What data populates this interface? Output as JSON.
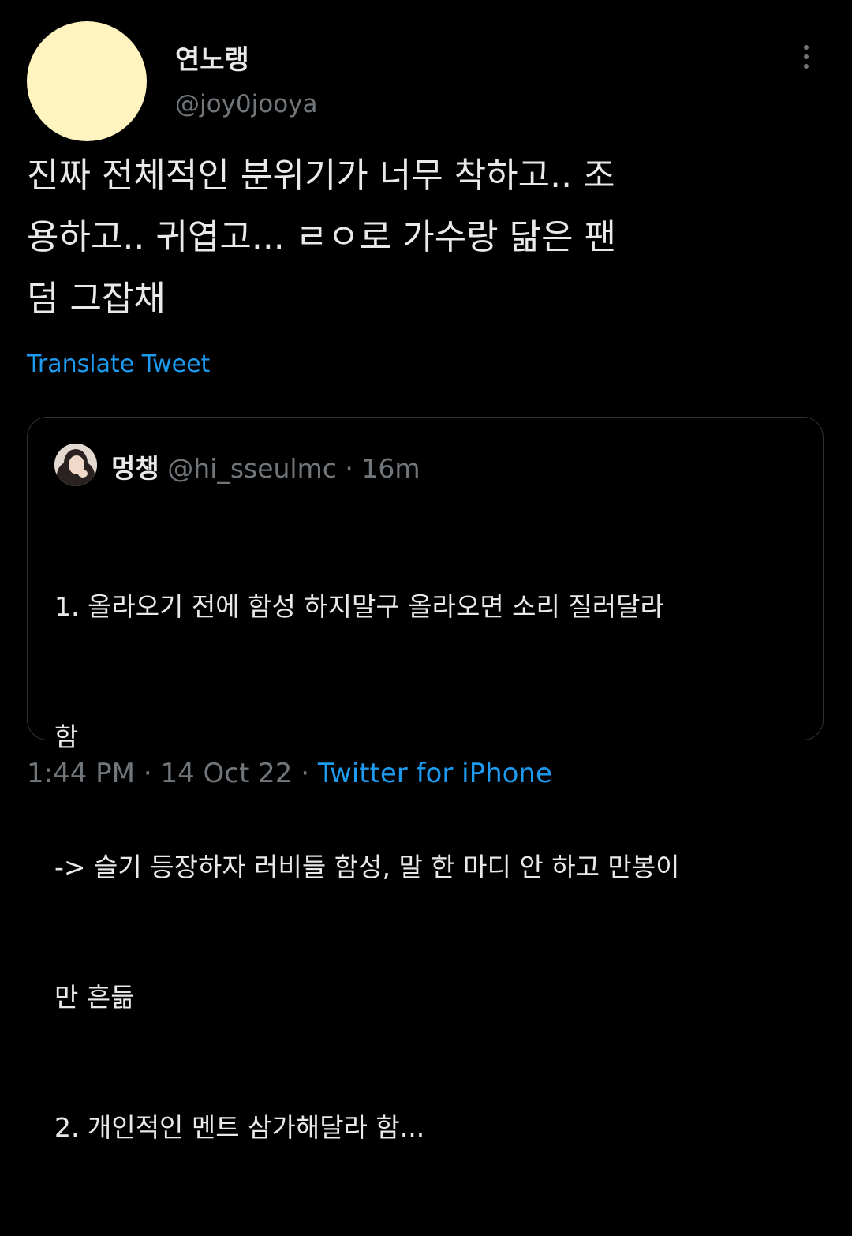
{
  "author": {
    "display_name": "연노랭",
    "handle": "@joy0jooya",
    "avatar_color": "#fff4c0"
  },
  "actions": {
    "more_icon": "more-vertical-icon"
  },
  "tweet": {
    "text": "진짜 전체적인 분위기가 너무 착하고.. 조\n용하고.. 귀엽고... ㄹㅇ로 가수랑 닮은 팬\n덤 그잡채",
    "translate_label": "Translate Tweet"
  },
  "quote": {
    "display_name": "멍챙",
    "handle": "@hi_sseulmc",
    "separator": "·",
    "time": "16m",
    "lines": [
      "1. 올라오기 전에 함성 하지말구 올라오면 소리 질러달라",
      "함",
      "-> 슬기 등장하자 러비들 함성, 말 한 마디 안 하고 만봉이",
      "만 흔듦",
      "2. 개인적인 멘트 삼가해달라 함..."
    ]
  },
  "meta": {
    "time": "1:44 PM",
    "sep1": "·",
    "date": "14 Oct 22",
    "sep2": "·",
    "source": "Twitter for iPhone"
  },
  "colors": {
    "background": "#000000",
    "text": "#e7e9ea",
    "secondary": "#71767b",
    "link": "#1d9bf0",
    "border": "#2f3336"
  }
}
